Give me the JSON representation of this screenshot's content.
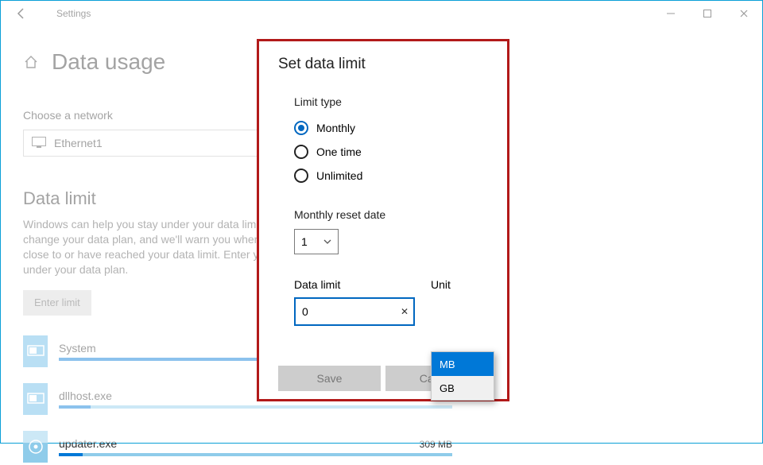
{
  "window": {
    "title": "Settings"
  },
  "page": {
    "title": "Data usage",
    "choose_network_label": "Choose a network",
    "selected_network": "Ethernet1"
  },
  "data_limit": {
    "section_title": "Data limit",
    "description": "Windows can help you stay under your data limit. This won't change your data plan, and we'll warn you when you're getting close to or have reached your data limit. Enter your limit to stay under your data plan.",
    "enter_limit_button": "Enter limit"
  },
  "apps": [
    {
      "name": "System",
      "usage": "",
      "bar_fill_pct": 92
    },
    {
      "name": "dllhost.exe",
      "usage": "",
      "bar_fill_pct": 8
    },
    {
      "name": "updater.exe",
      "usage": "309 MB",
      "bar_fill_pct": 6
    }
  ],
  "dialog": {
    "title": "Set data limit",
    "limit_type_label": "Limit type",
    "limit_types": [
      {
        "label": "Monthly",
        "checked": true
      },
      {
        "label": "One time",
        "checked": false
      },
      {
        "label": "Unlimited",
        "checked": false
      }
    ],
    "reset_label": "Monthly reset date",
    "reset_value": "1",
    "data_limit_label": "Data limit",
    "data_limit_value": "0",
    "unit_label": "Unit",
    "unit_options": [
      "MB",
      "GB"
    ],
    "unit_selected": "MB",
    "save_label": "Save",
    "cancel_label": "Cancel"
  }
}
